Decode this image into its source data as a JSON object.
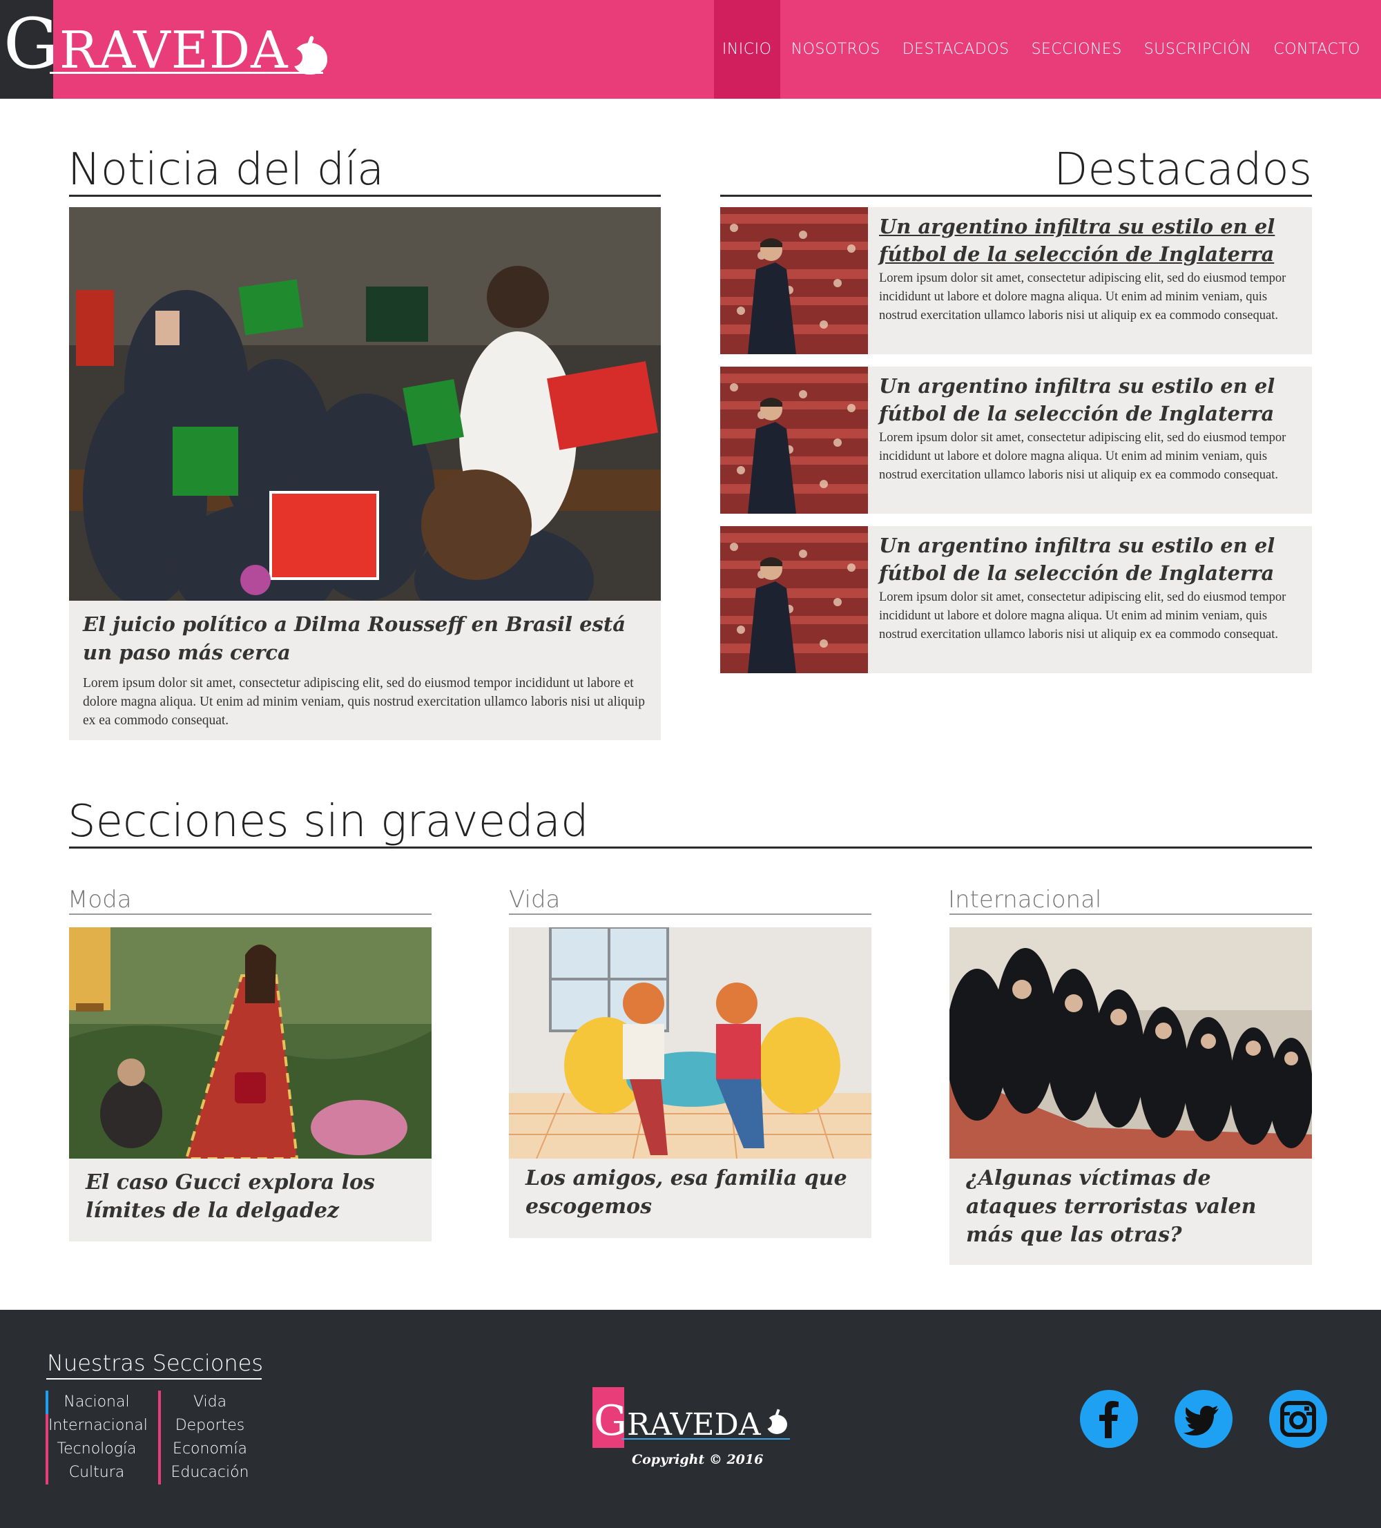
{
  "brand": {
    "logo_first": "G",
    "logo_rest": "RAVEDA",
    "primary_color": "#e83d78",
    "active_nav_color": "#d11e5c",
    "dark_color": "#2a2d31",
    "social_color": "#1ea1f2"
  },
  "nav": [
    "INICIO",
    "NOSOTROS",
    "DESTACADOS",
    "SECCIONES",
    "SUSCRIPCIÓN",
    "CONTACTO"
  ],
  "noticia": {
    "section_title": "Noticia del día",
    "headline": "El juicio político a Dilma Rousseff  en Brasil está un paso más cerca",
    "body": "Lorem ipsum dolor sit amet, consectetur adipiscing elit, sed do eiusmod tempor incididunt ut labore et dolore magna aliqua. Ut enim ad minim veniam, quis nostrud exercitation ullamco laboris nisi ut aliquip ex ea commodo consequat."
  },
  "destacados": {
    "section_title": "Destacados",
    "items": [
      {
        "headline": "Un argentino infiltra su estilo en el fútbol de la selección de Inglaterra",
        "body": "Lorem ipsum dolor sit amet, consectetur adipiscing elit, sed do eiusmod tempor incididunt ut labore et dolore magna aliqua. Ut enim ad minim veniam, quis nostrud exercitation ullamco laboris nisi ut aliquip ex ea commodo consequat."
      },
      {
        "headline": "Un argentino infiltra su estilo en el fútbol de la selección de Inglaterra",
        "body": "Lorem ipsum dolor sit amet, consectetur adipiscing elit, sed do eiusmod tempor incididunt ut labore et dolore magna aliqua. Ut enim ad minim veniam, quis nostrud exercitation ullamco laboris nisi ut aliquip ex ea commodo consequat."
      },
      {
        "headline": "Un argentino infiltra su estilo en el fútbol de la selección de Inglaterra",
        "body": "Lorem ipsum dolor sit amet, consectetur adipiscing elit, sed do eiusmod tempor incididunt ut labore et dolore magna aliqua. Ut enim ad minim veniam, quis nostrud exercitation ullamco laboris nisi ut aliquip ex ea commodo consequat."
      }
    ]
  },
  "secciones": {
    "section_title": "Secciones sin gravedad",
    "items": [
      {
        "category": "Moda",
        "headline": "El caso Gucci explora los límites de la delgadez"
      },
      {
        "category": "Vida",
        "headline": "Los amigos, esa familia que escogemos"
      },
      {
        "category": "Internacional",
        "headline": "¿Algunas víctimas de ataques terroristas valen más que las otras?"
      }
    ]
  },
  "footer": {
    "title": "Nuestras Secciones",
    "col1": [
      "Nacional",
      "Internacional",
      "Tecnología",
      "Cultura"
    ],
    "col2": [
      "Vida",
      "Deportes",
      "Economía",
      "Educación"
    ],
    "copyright": "Copyright © 2016",
    "social": [
      {
        "icon": "facebook-icon",
        "glyph": "f"
      },
      {
        "icon": "twitter-icon",
        "glyph": ""
      },
      {
        "icon": "instagram-icon",
        "glyph": ""
      }
    ]
  }
}
